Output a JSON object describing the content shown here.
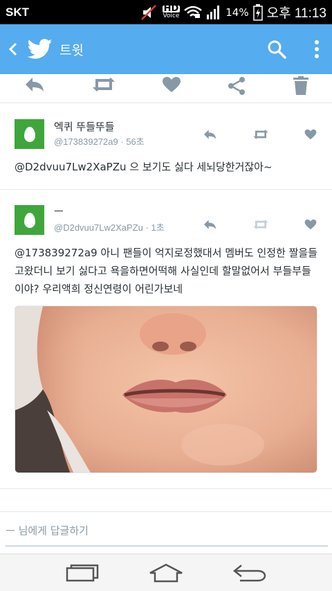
{
  "status": {
    "carrier": "SKT",
    "hd_voice_top": "HD",
    "hd_voice_bottom": "Voice",
    "battery": "14%",
    "time": "오후 11:13"
  },
  "appbar": {
    "title": "트윗",
    "color": "#55acee"
  },
  "tweets": [
    {
      "name": "엑퀴 뚜들뚜들",
      "handle": "@173839272a9",
      "sep": "·",
      "time": "56초",
      "text": "@D2dvuu7Lw2XaPZu 으 보기도 싫다 세뇌당한거잖아~"
    },
    {
      "name": "ㅡ",
      "handle": "@D2dvuu7Lw2XaPZu",
      "sep": "·",
      "time": "1초",
      "text": "@173839272a9 아니 팬들이 억지로정했대서 멤버도 인정한 짤을들고왔더니 보기 싫다고 욕을하면어떡해 사실인데 할말없어서 부들부들이야? 우리액희 정신연령이 어린가보네"
    }
  ],
  "reply": {
    "placeholder": "ㅡ 님에게 답글하기"
  },
  "icons": {
    "back": "back-arrow-icon",
    "logo": "twitter-bird-icon",
    "search": "search-icon",
    "more": "overflow-menu-icon",
    "reply": "reply-icon",
    "retweet": "retweet-icon",
    "favorite": "heart-icon",
    "share": "share-icon",
    "delete": "trash-icon"
  }
}
